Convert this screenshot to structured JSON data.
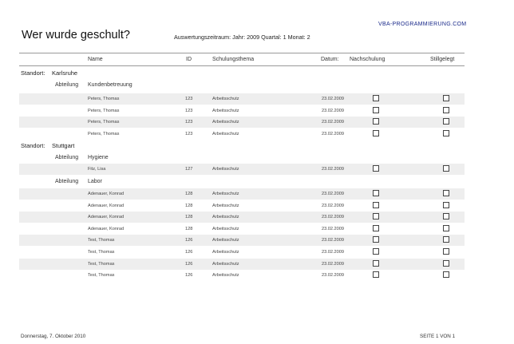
{
  "brand": "VBA-PROGRAMMIERUNG.COM",
  "title": "Wer wurde geschult?",
  "period": "Auswertungszeitraum: Jahr: 2009 Quartal: 1  Monat: 2",
  "columns": {
    "name": "Name",
    "id": "ID",
    "topic": "Schulungsthema",
    "date": "Datum:",
    "followup": "Nachschulung",
    "archived": "Stillgelegt"
  },
  "location_label": "Standort:",
  "department_label": "Abteilung",
  "locations": [
    {
      "name": "Karlsruhe",
      "departments": [
        {
          "name": "Kundenbetreuung",
          "rows": [
            {
              "name": "Peters, Thomas",
              "id": "123",
              "topic": "Arbeitsschutz",
              "date": "23.02.2009"
            },
            {
              "name": "Peters, Thomas",
              "id": "123",
              "topic": "Arbeitsschutz",
              "date": "23.02.2009"
            },
            {
              "name": "Peters, Thomas",
              "id": "123",
              "topic": "Arbeitsschutz",
              "date": "23.02.2009"
            },
            {
              "name": "Peters, Thomas",
              "id": "123",
              "topic": "Arbeitsschutz",
              "date": "23.02.2009"
            }
          ]
        }
      ]
    },
    {
      "name": "Stuttgart",
      "departments": [
        {
          "name": "Hygiene",
          "rows": [
            {
              "name": "Fitz, Lisa",
              "id": "127",
              "topic": "Arbeitsschutz",
              "date": "23.02.2009"
            }
          ]
        },
        {
          "name": "Labor",
          "rows": [
            {
              "name": "Adenauer, Konrad",
              "id": "128",
              "topic": "Arbeitsschutz",
              "date": "23.02.2009"
            },
            {
              "name": "Adenauer, Konrad",
              "id": "128",
              "topic": "Arbeitsschutz",
              "date": "23.02.2009"
            },
            {
              "name": "Adenauer, Konrad",
              "id": "128",
              "topic": "Arbeitsschutz",
              "date": "23.02.2009"
            },
            {
              "name": "Adenauer, Konrad",
              "id": "128",
              "topic": "Arbeitsschutz",
              "date": "23.02.2009"
            },
            {
              "name": "Test, Thomas",
              "id": "126",
              "topic": "Arbeitsschutz",
              "date": "23.02.2009"
            },
            {
              "name": "Test, Thomas",
              "id": "126",
              "topic": "Arbeitsschutz",
              "date": "23.02.2009"
            },
            {
              "name": "Test, Thomas",
              "id": "126",
              "topic": "Arbeitsschutz",
              "date": "23.02.2009"
            },
            {
              "name": "Test, Thomas",
              "id": "126",
              "topic": "Arbeitsschutz",
              "date": "23.02.2009"
            }
          ]
        }
      ]
    }
  ],
  "footer": {
    "date": "Donnerstag, 7. Oktober 2010",
    "page": "SEITE 1 VON 1"
  },
  "colors": {
    "brand": "#1a2a8a",
    "row_alt": "#eeeeee",
    "rule": "#9a9a9a"
  }
}
